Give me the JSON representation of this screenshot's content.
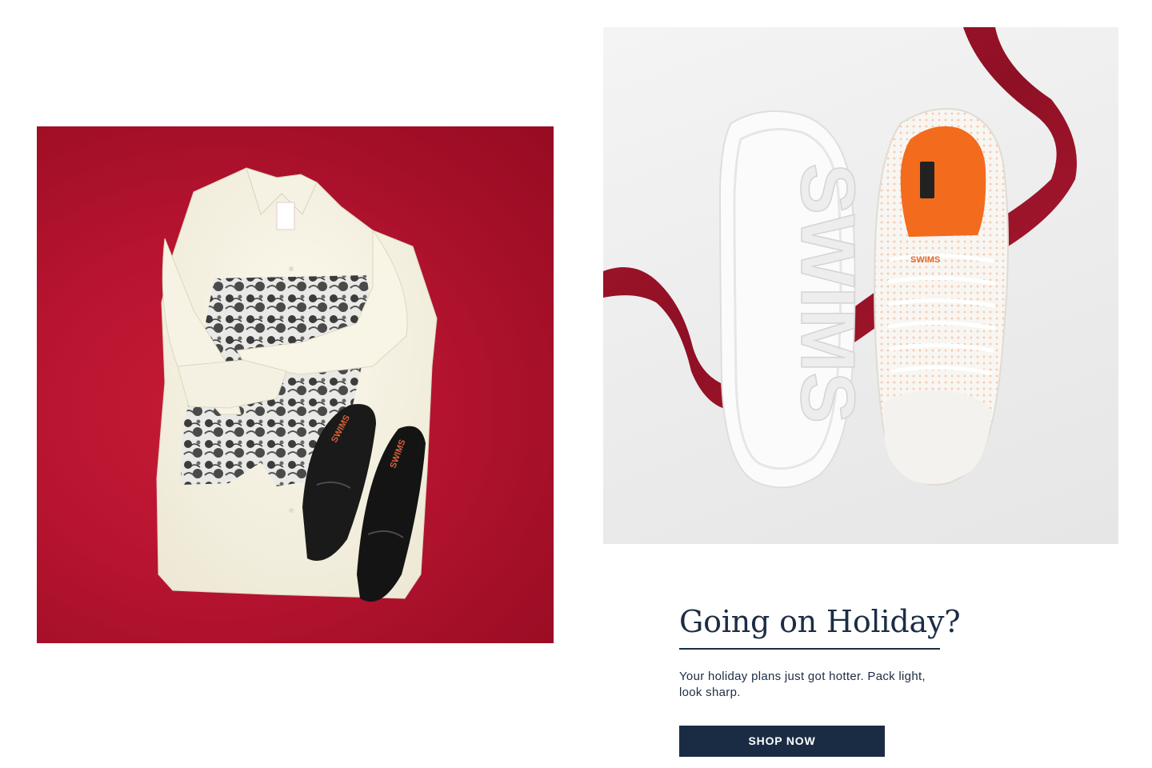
{
  "left_image": {
    "logo_text": "SWIMS"
  },
  "right_image": {
    "sole_logo_text": "SWIMS",
    "upper_logo_text": "SWIMS"
  },
  "promo": {
    "title": "Going on Holiday?",
    "description": "Your holiday plans just got hotter. Pack light, look sharp.",
    "cta_label": "SHOP NOW"
  },
  "colors": {
    "red_backdrop": "#b81430",
    "navy": "#1c2d44",
    "ribbon": "#a3132b",
    "insole_orange": "#f36b1c"
  }
}
